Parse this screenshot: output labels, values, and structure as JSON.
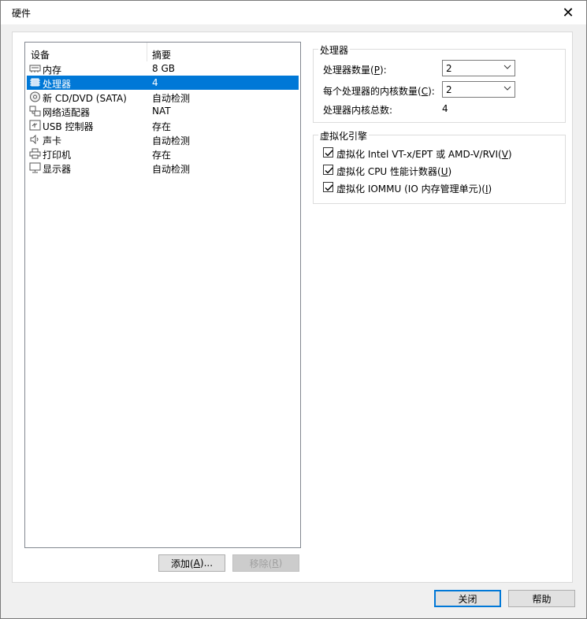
{
  "window": {
    "title": "硬件",
    "close_icon": "close-icon"
  },
  "device_list": {
    "columns": [
      "设备",
      "摘要"
    ],
    "rows": [
      {
        "name": "内存",
        "summary": "8 GB",
        "icon": "memory-icon"
      },
      {
        "name": "处理器",
        "summary": "4",
        "icon": "cpu-icon",
        "selected": true
      },
      {
        "name": "新 CD/DVD (SATA)",
        "summary": "自动检测",
        "icon": "cd-icon"
      },
      {
        "name": "网络适配器",
        "summary": "NAT",
        "icon": "network-icon"
      },
      {
        "name": "USB 控制器",
        "summary": "存在",
        "icon": "usb-icon"
      },
      {
        "name": "声卡",
        "summary": "自动检测",
        "icon": "speaker-icon"
      },
      {
        "name": "打印机",
        "summary": "存在",
        "icon": "printer-icon"
      },
      {
        "name": "显示器",
        "summary": "自动检测",
        "icon": "monitor-icon"
      }
    ]
  },
  "list_buttons": {
    "add": {
      "text": "添加(",
      "key": "A",
      "suffix": ")..."
    },
    "remove": {
      "text": "移除(",
      "key": "R",
      "suffix": ")"
    }
  },
  "processor": {
    "title": "处理器",
    "count_label": {
      "text": "处理器数量(",
      "key": "P",
      "suffix": "):"
    },
    "count_value": "2",
    "cores_label": {
      "text": "每个处理器的内核数量(",
      "key": "C",
      "suffix": "):"
    },
    "cores_value": "2",
    "total_label": "处理器内核总数:",
    "total_value": "4"
  },
  "virtualization": {
    "title": "虚拟化引擎",
    "options": [
      {
        "text": "虚拟化 Intel VT-x/EPT 或 AMD-V/RVI(",
        "key": "V",
        "suffix": ")",
        "checked": true
      },
      {
        "text": "虚拟化 CPU 性能计数器(",
        "key": "U",
        "suffix": ")",
        "checked": true
      },
      {
        "text": "虚拟化 IOMMU (IO 内存管理单元)(",
        "key": "I",
        "suffix": ")",
        "checked": true
      }
    ]
  },
  "footer": {
    "close_label": "关闭",
    "help_label": "帮助"
  }
}
